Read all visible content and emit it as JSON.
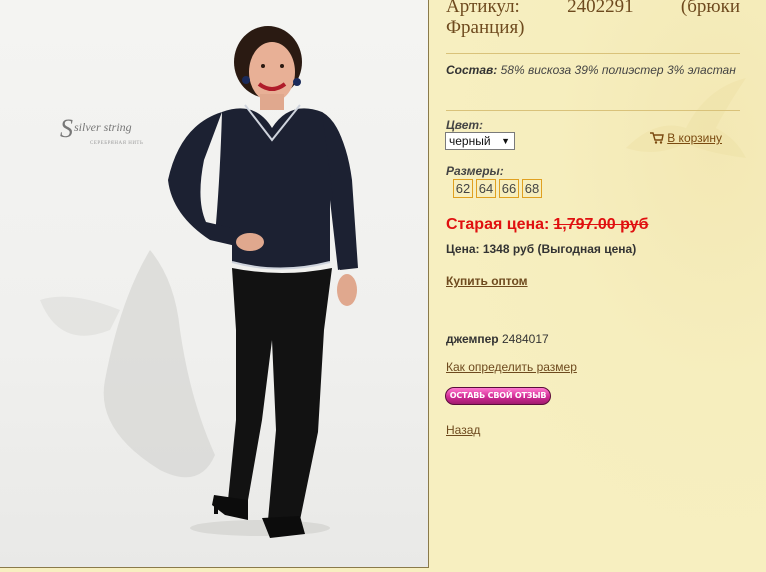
{
  "brand": {
    "logo_letter": "S",
    "logo_name": "silver string",
    "logo_sub": "СЕРЕБРЯНАЯ НИТЬ"
  },
  "product": {
    "title_word": "Артикул:",
    "article": "2402291",
    "title_paren_open": "(брюки",
    "title_line2": "Франция)",
    "composition_label": "Состав:",
    "composition": "58% вискоза 39% полиэстер 3% эластан",
    "color_label": "Цвет:",
    "color_value": "черный",
    "cart_label": "В корзину",
    "sizes_label": "Размеры:",
    "sizes": [
      "62",
      "64",
      "66",
      "68"
    ],
    "old_price_label": "Старая цена:",
    "old_price": "1,797.00 руб",
    "price": "Цена: 1348 руб (Выгодная цена)",
    "wholesale_link": "Купить оптом",
    "related_name": "джемпер",
    "related_code": "2484017",
    "size_guide_link": "Как определить размер",
    "review_button": "ОСТАВЬ СВОЙ ОТЗЫВ",
    "back_link": "Назад"
  },
  "colors": {
    "accent": "#6e4a1e",
    "price_red": "#e01010",
    "panel_bg": "#f7efc0"
  }
}
